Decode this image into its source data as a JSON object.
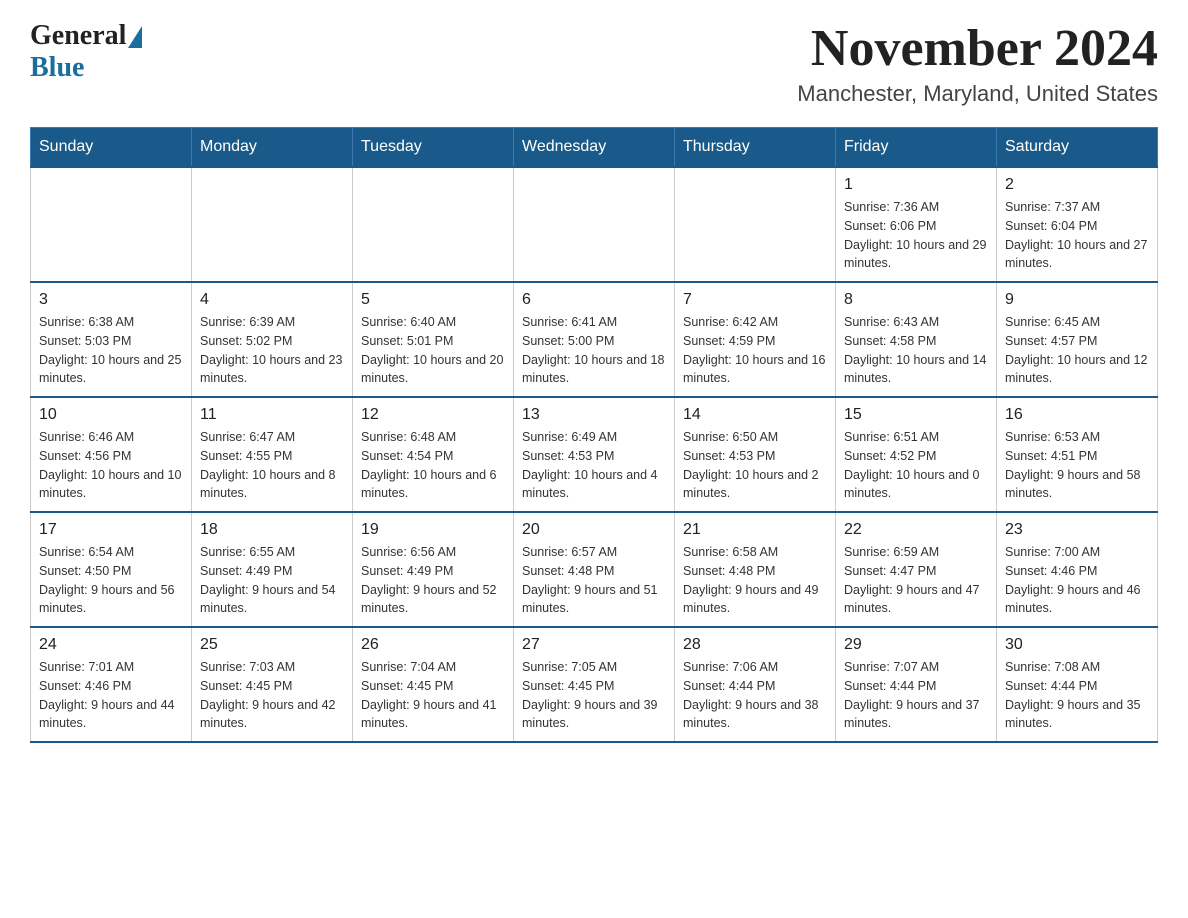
{
  "logo": {
    "general": "General",
    "blue": "Blue"
  },
  "header": {
    "month_year": "November 2024",
    "location": "Manchester, Maryland, United States"
  },
  "weekdays": [
    "Sunday",
    "Monday",
    "Tuesday",
    "Wednesday",
    "Thursday",
    "Friday",
    "Saturday"
  ],
  "weeks": [
    [
      {
        "day": "",
        "info": ""
      },
      {
        "day": "",
        "info": ""
      },
      {
        "day": "",
        "info": ""
      },
      {
        "day": "",
        "info": ""
      },
      {
        "day": "",
        "info": ""
      },
      {
        "day": "1",
        "info": "Sunrise: 7:36 AM\nSunset: 6:06 PM\nDaylight: 10 hours and 29 minutes."
      },
      {
        "day": "2",
        "info": "Sunrise: 7:37 AM\nSunset: 6:04 PM\nDaylight: 10 hours and 27 minutes."
      }
    ],
    [
      {
        "day": "3",
        "info": "Sunrise: 6:38 AM\nSunset: 5:03 PM\nDaylight: 10 hours and 25 minutes."
      },
      {
        "day": "4",
        "info": "Sunrise: 6:39 AM\nSunset: 5:02 PM\nDaylight: 10 hours and 23 minutes."
      },
      {
        "day": "5",
        "info": "Sunrise: 6:40 AM\nSunset: 5:01 PM\nDaylight: 10 hours and 20 minutes."
      },
      {
        "day": "6",
        "info": "Sunrise: 6:41 AM\nSunset: 5:00 PM\nDaylight: 10 hours and 18 minutes."
      },
      {
        "day": "7",
        "info": "Sunrise: 6:42 AM\nSunset: 4:59 PM\nDaylight: 10 hours and 16 minutes."
      },
      {
        "day": "8",
        "info": "Sunrise: 6:43 AM\nSunset: 4:58 PM\nDaylight: 10 hours and 14 minutes."
      },
      {
        "day": "9",
        "info": "Sunrise: 6:45 AM\nSunset: 4:57 PM\nDaylight: 10 hours and 12 minutes."
      }
    ],
    [
      {
        "day": "10",
        "info": "Sunrise: 6:46 AM\nSunset: 4:56 PM\nDaylight: 10 hours and 10 minutes."
      },
      {
        "day": "11",
        "info": "Sunrise: 6:47 AM\nSunset: 4:55 PM\nDaylight: 10 hours and 8 minutes."
      },
      {
        "day": "12",
        "info": "Sunrise: 6:48 AM\nSunset: 4:54 PM\nDaylight: 10 hours and 6 minutes."
      },
      {
        "day": "13",
        "info": "Sunrise: 6:49 AM\nSunset: 4:53 PM\nDaylight: 10 hours and 4 minutes."
      },
      {
        "day": "14",
        "info": "Sunrise: 6:50 AM\nSunset: 4:53 PM\nDaylight: 10 hours and 2 minutes."
      },
      {
        "day": "15",
        "info": "Sunrise: 6:51 AM\nSunset: 4:52 PM\nDaylight: 10 hours and 0 minutes."
      },
      {
        "day": "16",
        "info": "Sunrise: 6:53 AM\nSunset: 4:51 PM\nDaylight: 9 hours and 58 minutes."
      }
    ],
    [
      {
        "day": "17",
        "info": "Sunrise: 6:54 AM\nSunset: 4:50 PM\nDaylight: 9 hours and 56 minutes."
      },
      {
        "day": "18",
        "info": "Sunrise: 6:55 AM\nSunset: 4:49 PM\nDaylight: 9 hours and 54 minutes."
      },
      {
        "day": "19",
        "info": "Sunrise: 6:56 AM\nSunset: 4:49 PM\nDaylight: 9 hours and 52 minutes."
      },
      {
        "day": "20",
        "info": "Sunrise: 6:57 AM\nSunset: 4:48 PM\nDaylight: 9 hours and 51 minutes."
      },
      {
        "day": "21",
        "info": "Sunrise: 6:58 AM\nSunset: 4:48 PM\nDaylight: 9 hours and 49 minutes."
      },
      {
        "day": "22",
        "info": "Sunrise: 6:59 AM\nSunset: 4:47 PM\nDaylight: 9 hours and 47 minutes."
      },
      {
        "day": "23",
        "info": "Sunrise: 7:00 AM\nSunset: 4:46 PM\nDaylight: 9 hours and 46 minutes."
      }
    ],
    [
      {
        "day": "24",
        "info": "Sunrise: 7:01 AM\nSunset: 4:46 PM\nDaylight: 9 hours and 44 minutes."
      },
      {
        "day": "25",
        "info": "Sunrise: 7:03 AM\nSunset: 4:45 PM\nDaylight: 9 hours and 42 minutes."
      },
      {
        "day": "26",
        "info": "Sunrise: 7:04 AM\nSunset: 4:45 PM\nDaylight: 9 hours and 41 minutes."
      },
      {
        "day": "27",
        "info": "Sunrise: 7:05 AM\nSunset: 4:45 PM\nDaylight: 9 hours and 39 minutes."
      },
      {
        "day": "28",
        "info": "Sunrise: 7:06 AM\nSunset: 4:44 PM\nDaylight: 9 hours and 38 minutes."
      },
      {
        "day": "29",
        "info": "Sunrise: 7:07 AM\nSunset: 4:44 PM\nDaylight: 9 hours and 37 minutes."
      },
      {
        "day": "30",
        "info": "Sunrise: 7:08 AM\nSunset: 4:44 PM\nDaylight: 9 hours and 35 minutes."
      }
    ]
  ]
}
